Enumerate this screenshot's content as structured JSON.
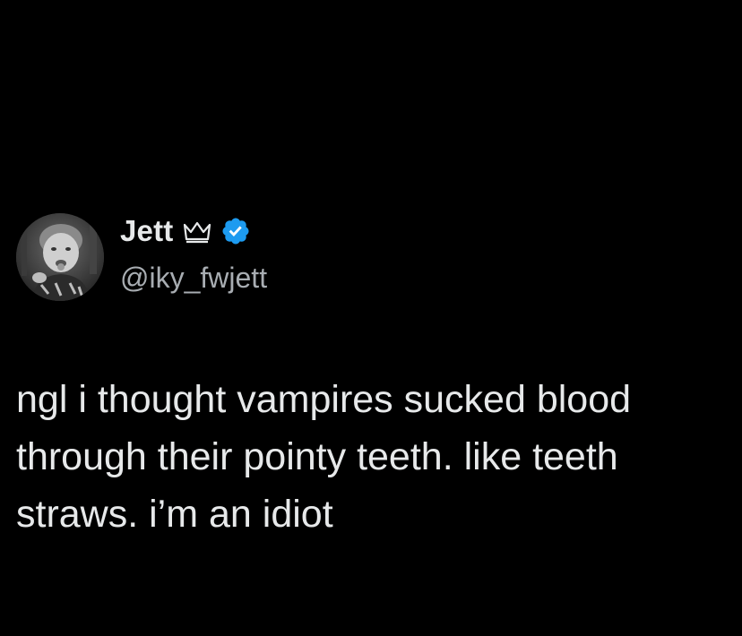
{
  "author": {
    "display_name": "Jett",
    "handle": "@iky_fwjett",
    "icons": [
      "crown-icon",
      "verified-badge-icon"
    ],
    "verified_color": "#1d9bf0"
  },
  "tweet": {
    "text": "ngl i thought vampires sucked blood\nthrough their pointy teeth. like teeth\nstraws. i’m an idiot"
  },
  "colors": {
    "background": "#000000",
    "primary_text": "#e7e9ea",
    "secondary_text": "#a8adb2"
  }
}
